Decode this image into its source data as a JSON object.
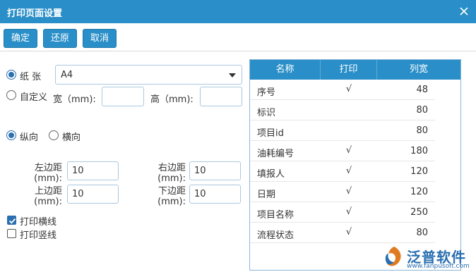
{
  "dialog": {
    "title": "打印页面设置"
  },
  "toolbar": {
    "ok_label": "确定",
    "reset_label": "还原",
    "cancel_label": "取消"
  },
  "paper": {
    "paper_label": "纸 张",
    "paper_value": "A4",
    "custom_label": "自定义",
    "width_label": "宽（mm):",
    "height_label": "高（mm):",
    "width_value": "",
    "height_value": ""
  },
  "orientation": {
    "portrait_label": "纵向",
    "landscape_label": "横向",
    "selected": "portrait"
  },
  "margins": {
    "left_label": "左边距\n(mm):",
    "right_label": "右边距\n(mm):",
    "top_label": "上边距\n(mm):",
    "bottom_label": "下边距\n(mm):",
    "left_value": "10",
    "right_value": "10",
    "top_value": "10",
    "bottom_value": "10"
  },
  "lines": {
    "horizontal_label": "打印横线",
    "horizontal_checked": true,
    "vertical_label": "打印竖线",
    "vertical_checked": false
  },
  "columns": {
    "headers": [
      "名称",
      "打印",
      "列宽"
    ],
    "rows": [
      {
        "name": "序号",
        "print": "√",
        "width": "48"
      },
      {
        "name": "标识",
        "print": "",
        "width": "80"
      },
      {
        "name": "项目id",
        "print": "",
        "width": "80"
      },
      {
        "name": "油耗编号",
        "print": "√",
        "width": "180"
      },
      {
        "name": "填报人",
        "print": "√",
        "width": "120"
      },
      {
        "name": "日期",
        "print": "√",
        "width": "120"
      },
      {
        "name": "项目名称",
        "print": "√",
        "width": "250"
      },
      {
        "name": "流程状态",
        "print": "√",
        "width": "80"
      }
    ]
  },
  "brand": {
    "name": "泛普软件",
    "url": "www.fanpusoft.com"
  },
  "colors": {
    "accent": "#2a8fc8",
    "border": "#8db6d6"
  }
}
